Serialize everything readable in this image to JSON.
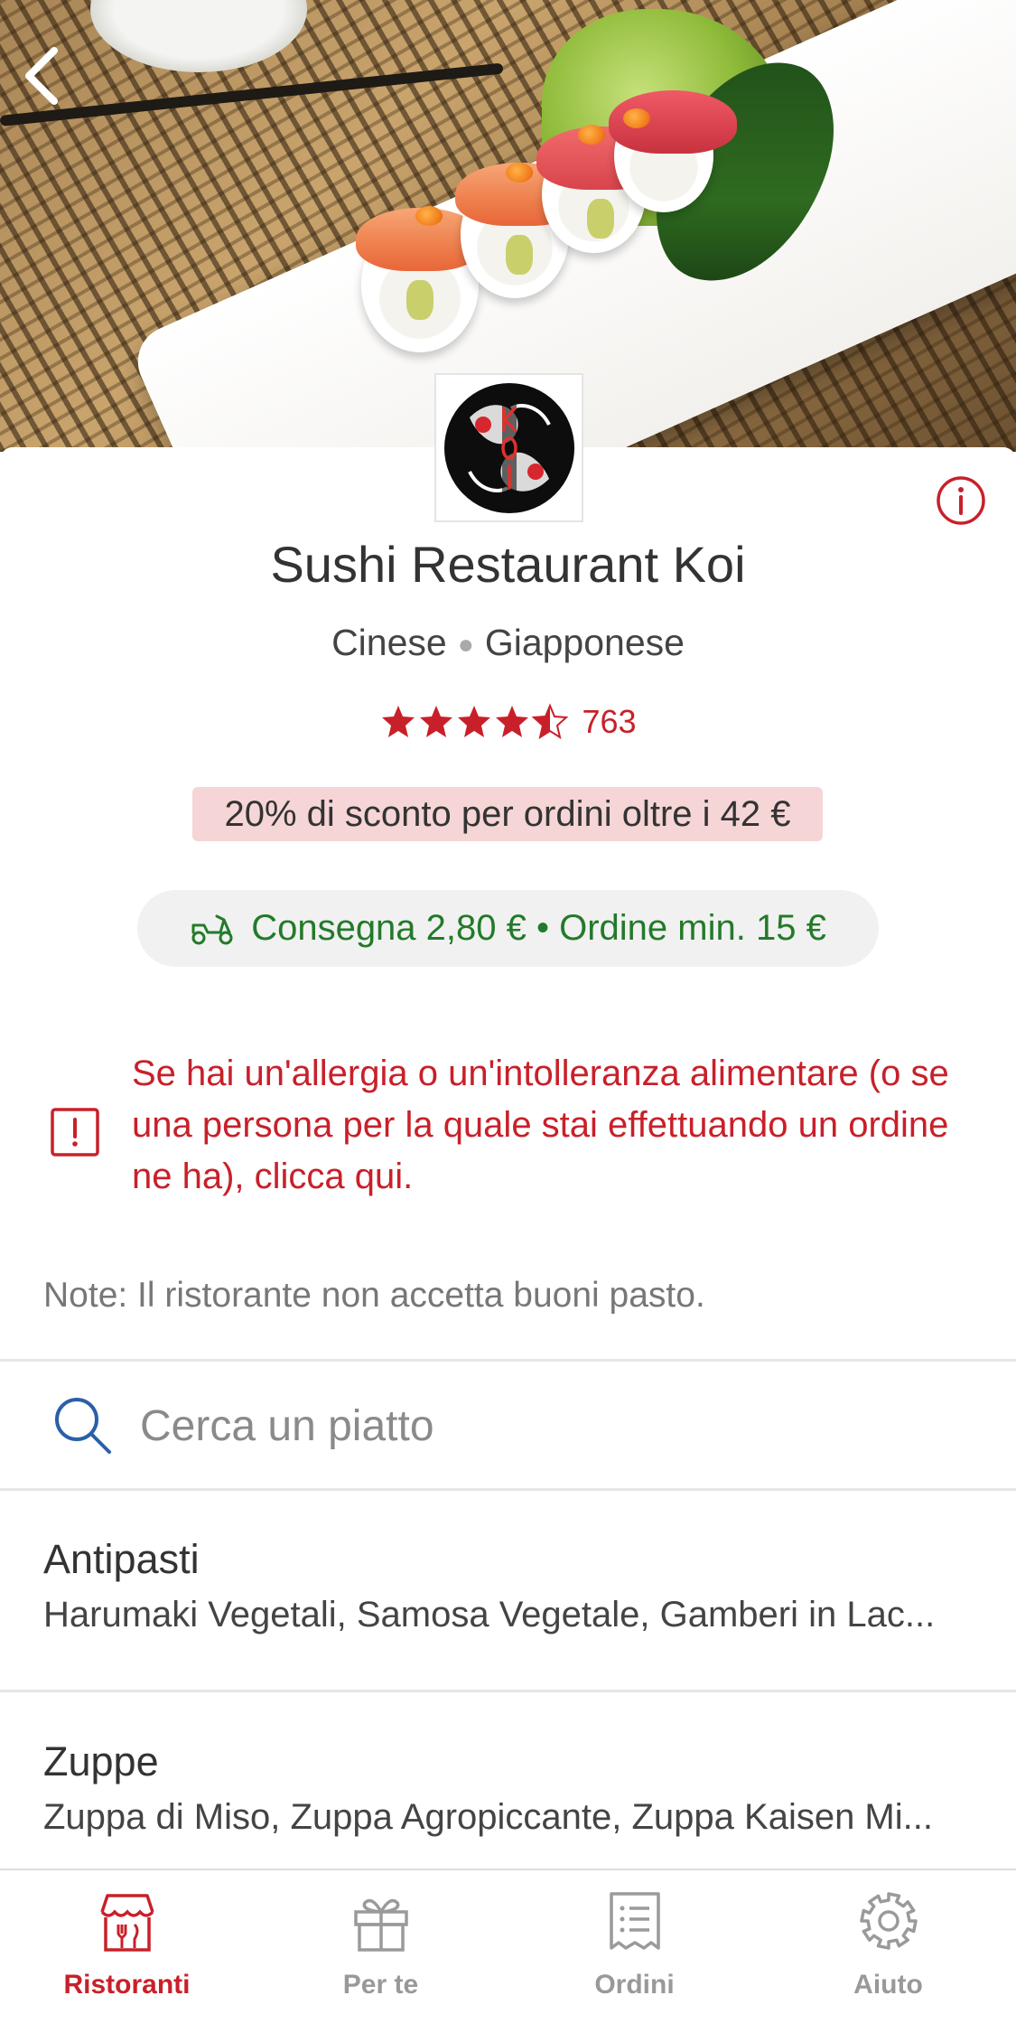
{
  "restaurant": {
    "name": "Sushi Restaurant Koi",
    "cuisines": [
      "Cinese",
      "Giapponese"
    ],
    "rating": 4.5,
    "rating_max": 5,
    "review_count": "763",
    "logo_text": "KOI"
  },
  "promo": {
    "discount": "20% di sconto per ordini oltre i 42 €"
  },
  "delivery": {
    "info": "Consegna 2,80 € • Ordine min. 15 €"
  },
  "allergy": {
    "message": "Se hai un'allergia o un'intolleranza alimentare (o se una persona per la quale stai effettuando un ordine ne ha), clicca qui."
  },
  "note": "Note: Il ristorante non accetta buoni pasto.",
  "search": {
    "placeholder": "Cerca un piatto"
  },
  "categories": [
    {
      "title": "Antipasti",
      "items": "Harumaki Vegetali, Samosa Vegetale, Gamberi in Lac..."
    },
    {
      "title": "Zuppe",
      "items": "Zuppa di Miso, Zuppa Agropiccante, Zuppa Kaisen Mi..."
    }
  ],
  "tabbar": {
    "items": [
      {
        "label": "Ristoranti",
        "icon": "restaurant-icon",
        "active": true
      },
      {
        "label": "Per te",
        "icon": "gift-icon",
        "active": false
      },
      {
        "label": "Ordini",
        "icon": "receipt-icon",
        "active": false
      },
      {
        "label": "Aiuto",
        "icon": "gear-icon",
        "active": false
      }
    ]
  },
  "colors": {
    "accent_red": "#c8202a",
    "delivery_green": "#237a2a",
    "promo_bg": "#f5d5d5",
    "pill_bg": "#f1f1f1"
  }
}
